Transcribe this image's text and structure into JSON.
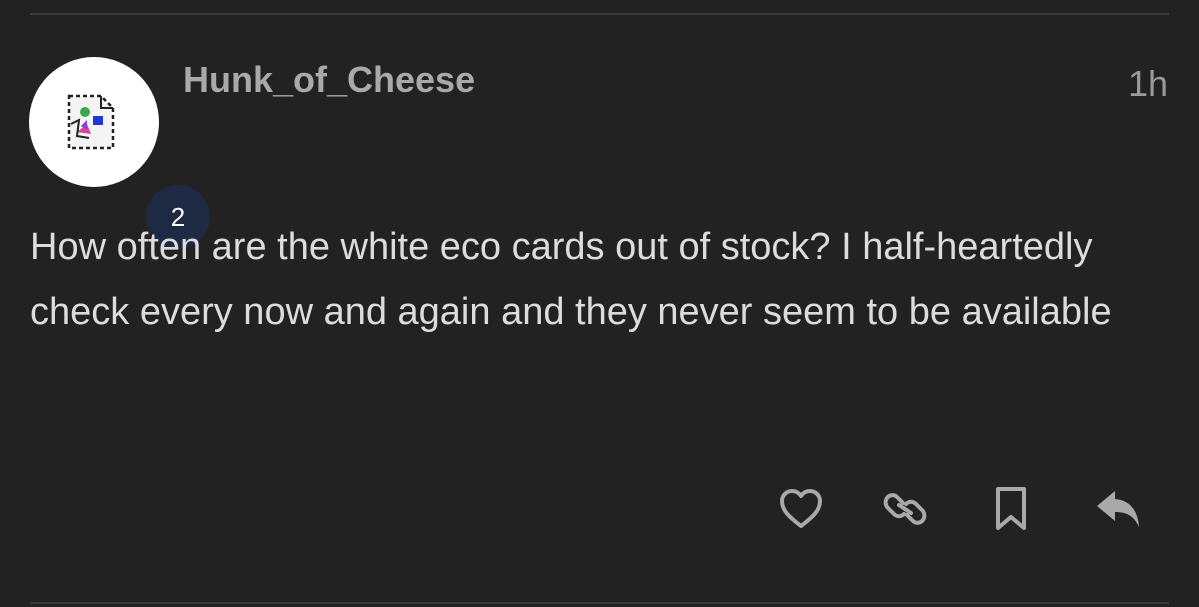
{
  "post": {
    "username": "Hunk_of_Cheese",
    "timestamp": "1h",
    "badge_count": "2",
    "body": "How often are the white eco cards out of stock? I half-heartedly check every now and again and they never seem to be available"
  },
  "avatar": {
    "icon": "broken-image-icon"
  },
  "actions": [
    {
      "icon": "heart-icon"
    },
    {
      "icon": "link-icon"
    },
    {
      "icon": "bookmark-icon"
    },
    {
      "icon": "reply-icon"
    }
  ],
  "colors": {
    "background": "#222222",
    "divider": "#3a3a3a",
    "username": "#a9a9a9",
    "body_text": "#dcdcdc",
    "badge_bg": "#1e2a44",
    "icon": "#a9a9a9"
  }
}
